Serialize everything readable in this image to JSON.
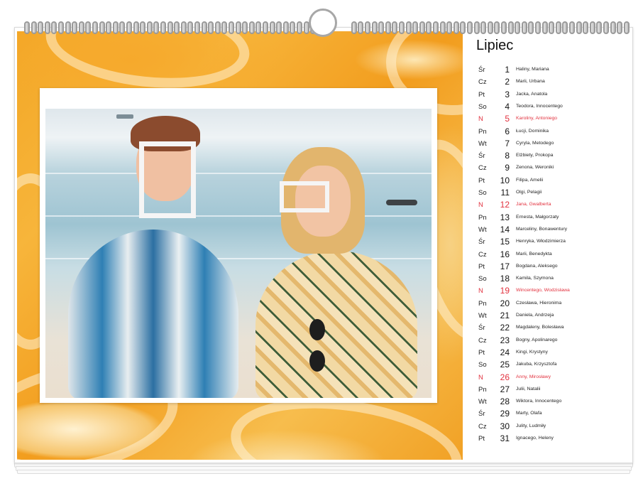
{
  "calendar": {
    "month": "Lipiec",
    "days": [
      {
        "dow": "Śr",
        "day": "1",
        "names": "Haliny, Mariana",
        "holiday": false
      },
      {
        "dow": "Cz",
        "day": "2",
        "names": "Marii, Urbana",
        "holiday": false
      },
      {
        "dow": "Pt",
        "day": "3",
        "names": "Jacka, Anatola",
        "holiday": false
      },
      {
        "dow": "So",
        "day": "4",
        "names": "Teodora, Innocentego",
        "holiday": false
      },
      {
        "dow": "N",
        "day": "5",
        "names": "Karoliny, Antoniego",
        "holiday": true
      },
      {
        "dow": "Pn",
        "day": "6",
        "names": "Łucji, Dominika",
        "holiday": false
      },
      {
        "dow": "Wt",
        "day": "7",
        "names": "Cyryla, Metodego",
        "holiday": false
      },
      {
        "dow": "Śr",
        "day": "8",
        "names": "Elżbiety, Prokopa",
        "holiday": false
      },
      {
        "dow": "Cz",
        "day": "9",
        "names": "Zenona, Weroniki",
        "holiday": false
      },
      {
        "dow": "Pt",
        "day": "10",
        "names": "Filipa, Amelii",
        "holiday": false
      },
      {
        "dow": "So",
        "day": "11",
        "names": "Olgi, Pelagii",
        "holiday": false
      },
      {
        "dow": "N",
        "day": "12",
        "names": "Jana, Gwalberta",
        "holiday": true
      },
      {
        "dow": "Pn",
        "day": "13",
        "names": "Ernesta, Małgorzaty",
        "holiday": false
      },
      {
        "dow": "Wt",
        "day": "14",
        "names": "Marceliny, Bonawentury",
        "holiday": false
      },
      {
        "dow": "Śr",
        "day": "15",
        "names": "Henryka, Włodzimierza",
        "holiday": false
      },
      {
        "dow": "Cz",
        "day": "16",
        "names": "Marii, Benedykta",
        "holiday": false
      },
      {
        "dow": "Pt",
        "day": "17",
        "names": "Bogdana, Aleksego",
        "holiday": false
      },
      {
        "dow": "So",
        "day": "18",
        "names": "Kamila, Szymona",
        "holiday": false
      },
      {
        "dow": "N",
        "day": "19",
        "names": "Wincentego, Wodzisława",
        "holiday": true
      },
      {
        "dow": "Pn",
        "day": "20",
        "names": "Czesława, Hieronima",
        "holiday": false
      },
      {
        "dow": "Wt",
        "day": "21",
        "names": "Daniela, Andrzeja",
        "holiday": false
      },
      {
        "dow": "Śr",
        "day": "22",
        "names": "Magdaleny, Bolesława",
        "holiday": false
      },
      {
        "dow": "Cz",
        "day": "23",
        "names": "Bogny, Apolinarego",
        "holiday": false
      },
      {
        "dow": "Pt",
        "day": "24",
        "names": "Kingi, Krystyny",
        "holiday": false
      },
      {
        "dow": "So",
        "day": "25",
        "names": "Jakuba, Krzysztofa",
        "holiday": false
      },
      {
        "dow": "N",
        "day": "26",
        "names": "Anny, Mirosławy",
        "holiday": true
      },
      {
        "dow": "Pn",
        "day": "27",
        "names": "Julii, Natalii",
        "holiday": false
      },
      {
        "dow": "Wt",
        "day": "28",
        "names": "Wiktora, Innocentego",
        "holiday": false
      },
      {
        "dow": "Śr",
        "day": "29",
        "names": "Marty, Olafa",
        "holiday": false
      },
      {
        "dow": "Cz",
        "day": "30",
        "names": "Julity, Ludmiły",
        "holiday": false
      },
      {
        "dow": "Pt",
        "day": "31",
        "names": "Ignacego, Heleny",
        "holiday": false
      }
    ]
  },
  "colors": {
    "holiday": "#e2323f",
    "background": "#f3a726",
    "text": "#111111"
  }
}
